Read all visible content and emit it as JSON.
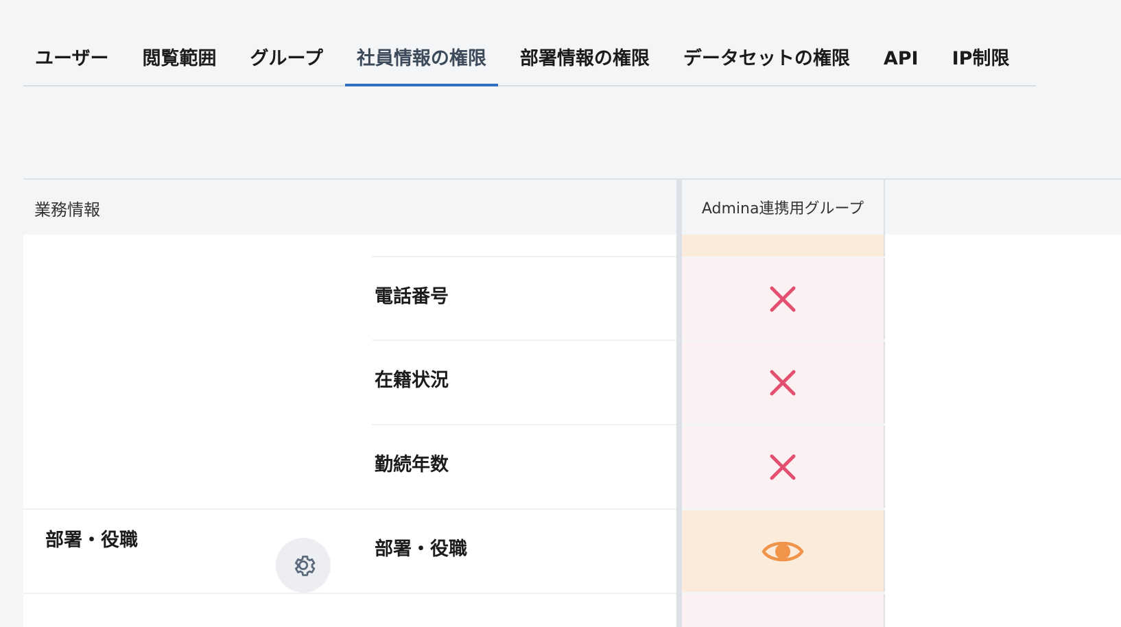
{
  "tabs": [
    {
      "label": "ユーザー",
      "active": false
    },
    {
      "label": "閲覧範囲",
      "active": false
    },
    {
      "label": "グループ",
      "active": false
    },
    {
      "label": "社員情報の権限",
      "active": true
    },
    {
      "label": "部署情報の権限",
      "active": false
    },
    {
      "label": "データセットの権限",
      "active": false
    },
    {
      "label": "API",
      "active": false
    },
    {
      "label": "IP制限",
      "active": false
    }
  ],
  "table": {
    "section_header": "業務情報",
    "group_column": "Admina連携用グループ",
    "category_label": "部署・役職",
    "rows": [
      {
        "label": "電話番号",
        "permission": "none"
      },
      {
        "label": "在籍状況",
        "permission": "none"
      },
      {
        "label": "勤続年数",
        "permission": "none"
      },
      {
        "label": "部署・役職",
        "permission": "view"
      }
    ]
  },
  "colors": {
    "accent": "#2e6fc0",
    "deny_icon": "#e3506f",
    "view_icon": "#f0944a",
    "view_cell_bg": "#fbebdb",
    "deny_cell_bg": "#fbf1f3"
  },
  "icons": {
    "deny": "close-icon",
    "view": "eye-icon",
    "settings": "gear-icon"
  }
}
